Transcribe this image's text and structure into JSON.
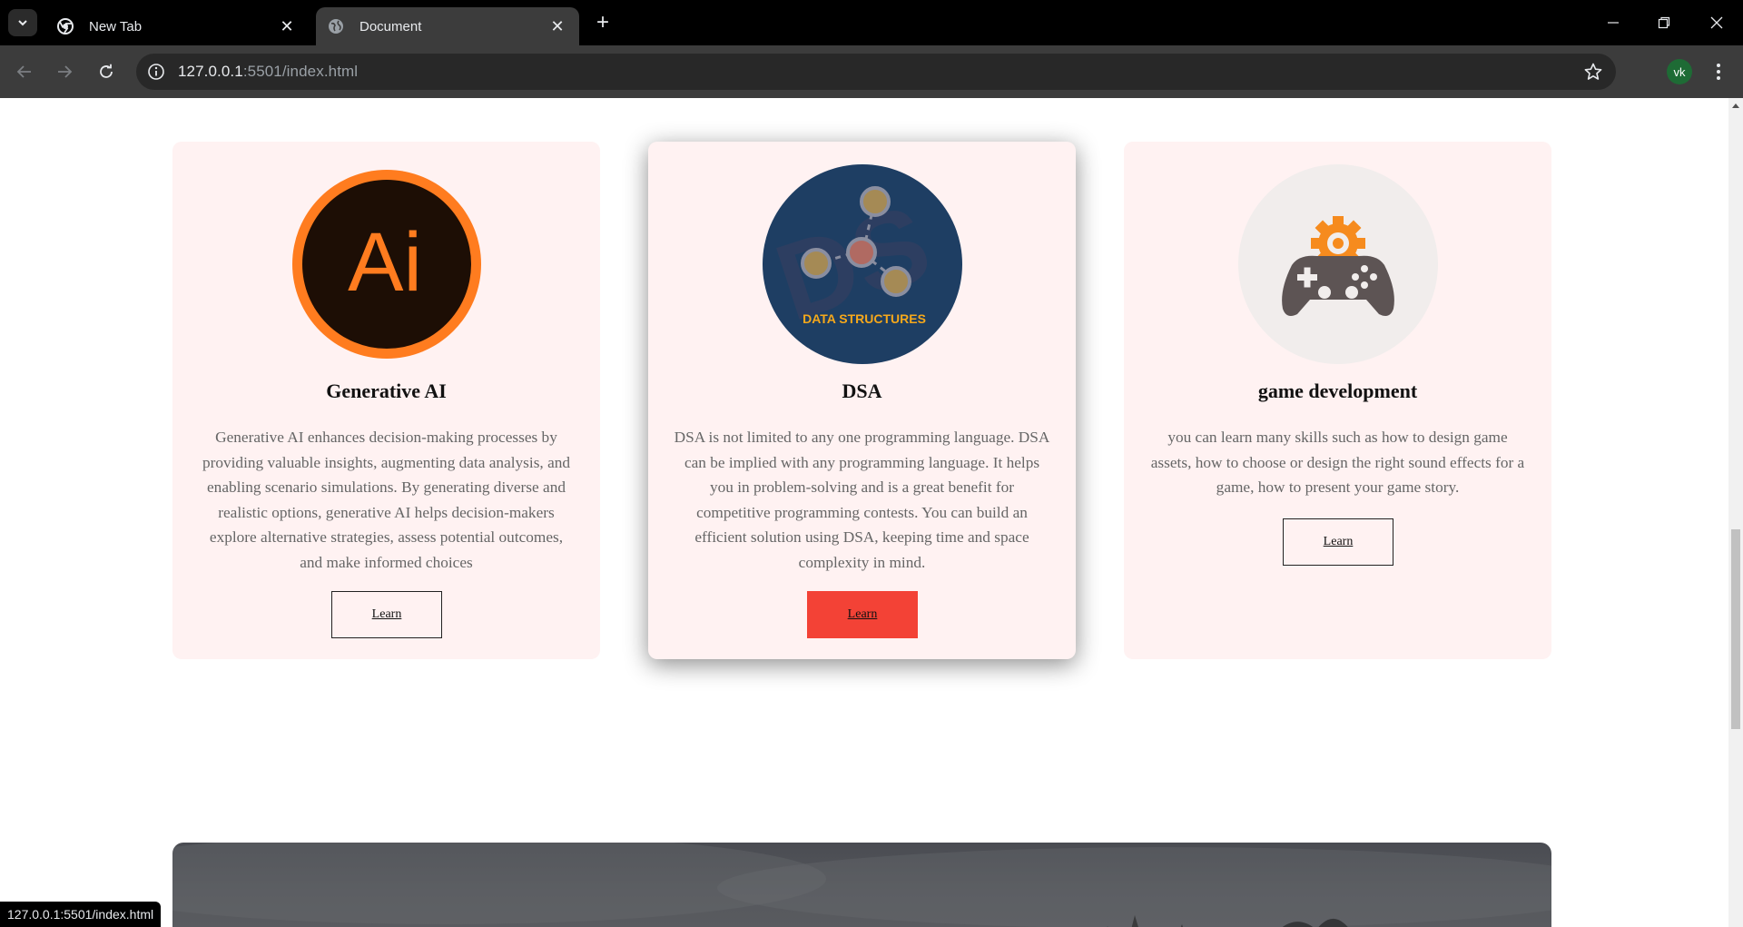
{
  "browser": {
    "tabs": [
      {
        "title": "New Tab",
        "active": false,
        "favicon": "chrome-icon"
      },
      {
        "title": "Document",
        "active": true,
        "favicon": "globe-icon"
      }
    ],
    "url_host": "127.0.0.1",
    "url_rest": ":5501/index.html",
    "profile_initials": "vk",
    "status_url": "127.0.0.1:5501/index.html"
  },
  "cards": [
    {
      "title": "Generative AI",
      "icon": "adobe-illustrator-ai-icon",
      "icon_text": "Ai",
      "description": "Generative AI enhances decision-making processes by providing valuable insights, augmenting data analysis, and enabling scenario simulations. By generating diverse and realistic options, generative AI helps decision-makers explore alternative strategies, assess potential outcomes, and make informed choices",
      "button": "Learn"
    },
    {
      "title": "DSA",
      "icon": "data-structures-icon",
      "icon_text": "DATA STRUCTURES",
      "description": "DSA is not limited to any one programming language. DSA can be implied with any programming language. It helps you in problem-solving and is a great benefit for competitive programming contests. You can build an efficient solution using DSA, keeping time and space complexity in mind.",
      "button": "Learn"
    },
    {
      "title": "game development",
      "icon": "gamepad-gear-icon",
      "description": "you can learn many skills such as how to design game assets, how to choose or design the right sound effects for a game, how to present your game story.",
      "button": "Learn"
    }
  ],
  "colors": {
    "card_bg": "#fff2f2",
    "active_button": "#f34236",
    "ai_orange": "#ff7c1f",
    "ai_dark": "#1d0e05",
    "ds_navy": "#1e3e63",
    "ds_yellow": "#f6a81b",
    "gear_orange": "#f68b1e",
    "gamepad_gray": "#5d5454"
  }
}
